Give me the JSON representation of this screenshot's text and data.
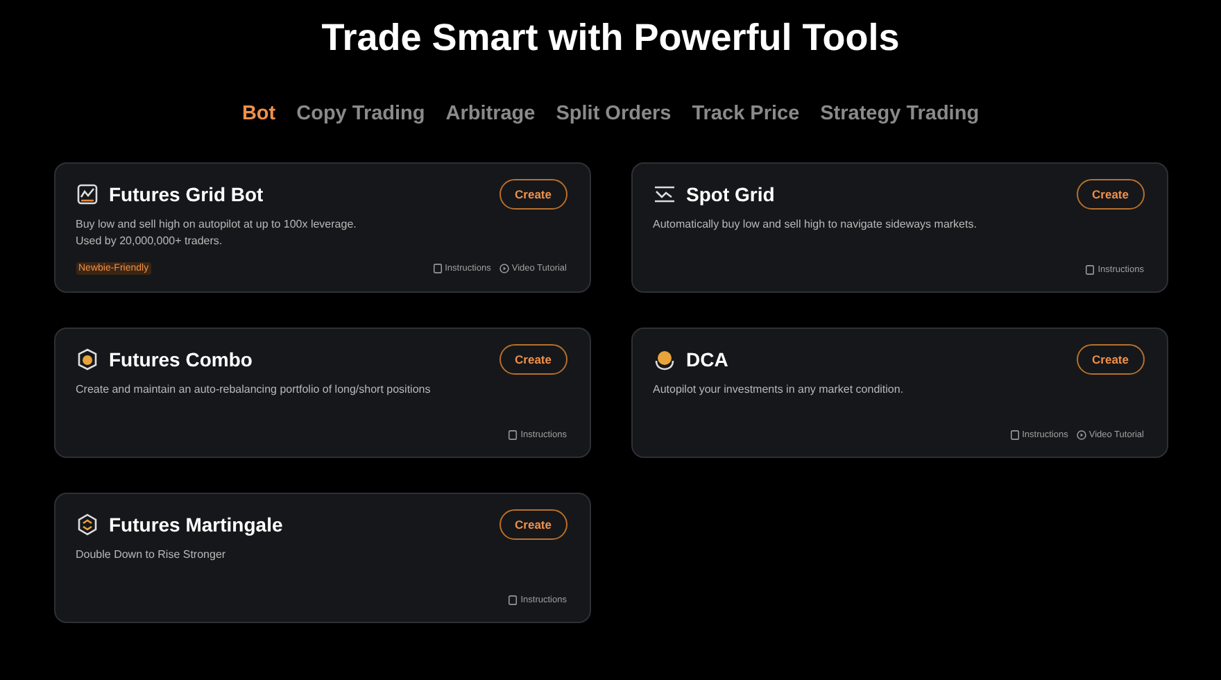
{
  "heading": "Trade Smart with Powerful Tools",
  "tabs": [
    {
      "label": "Bot",
      "selected": true
    },
    {
      "label": "Copy Trading",
      "selected": false
    },
    {
      "label": "Arbitrage",
      "selected": false
    },
    {
      "label": "Split Orders",
      "selected": false
    },
    {
      "label": "Track Price",
      "selected": false
    },
    {
      "label": "Strategy Trading",
      "selected": false
    }
  ],
  "cards": [
    {
      "title": "Futures Grid Bot",
      "button": "Create",
      "description": [
        "Buy low and sell high on autopilot at up to 100x leverage.",
        "Used by 20,000,000+ traders."
      ],
      "tag": "Newbie-Friendly",
      "links": [
        {
          "kind": "instructions",
          "label": "Instructions"
        },
        {
          "kind": "video",
          "label": "Video Tutorial"
        }
      ]
    },
    {
      "title": "Spot Grid",
      "button": "Create",
      "description": [
        "Automatically buy low and sell high to navigate sideways markets."
      ],
      "links": [
        {
          "kind": "instructions",
          "label": "Instructions"
        }
      ]
    },
    {
      "title": "Futures Combo",
      "button": "Create",
      "description": [
        "Create and maintain an auto-rebalancing portfolio of long/short positions"
      ],
      "links": [
        {
          "kind": "instructions",
          "label": "Instructions"
        }
      ]
    },
    {
      "title": "DCA",
      "button": "Create",
      "description": [
        "Autopilot your investments in any market condition."
      ],
      "links": [
        {
          "kind": "instructions",
          "label": "Instructions"
        },
        {
          "kind": "video",
          "label": "Video Tutorial"
        }
      ]
    },
    {
      "title": "Futures Martingale",
      "button": "Create",
      "description": [
        "Double Down to Rise Stronger"
      ],
      "links": [
        {
          "kind": "instructions",
          "label": "Instructions"
        }
      ]
    }
  ]
}
